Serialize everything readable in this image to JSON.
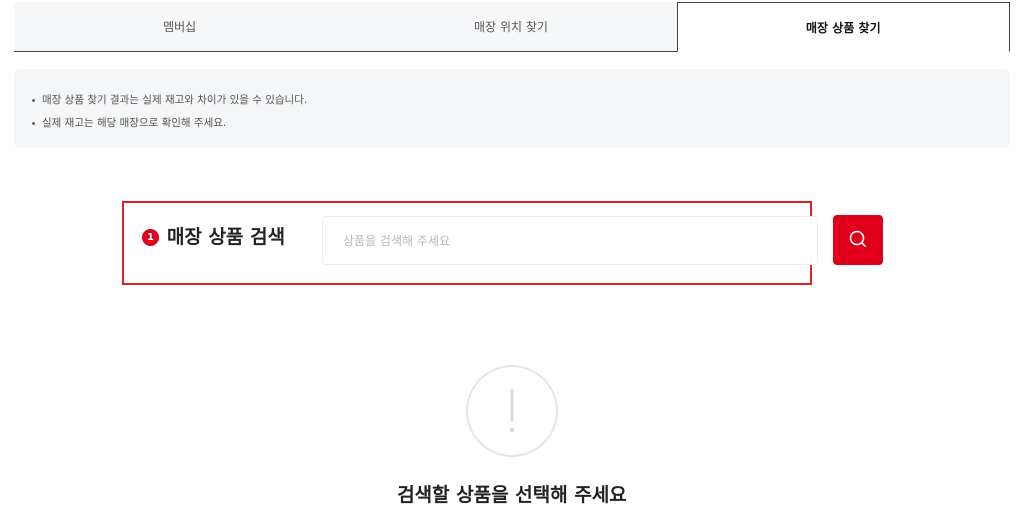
{
  "tabs": [
    {
      "label": "멤버십",
      "active": false
    },
    {
      "label": "매장 위치 찾기",
      "active": false
    },
    {
      "label": "매장 상품 찾기",
      "active": true
    }
  ],
  "notice": {
    "items": [
      "매장 상품 찾기 결과는 실제 재고와 차이가 있을 수 있습니다.",
      "실제 재고는 해당 매장으로 확인해 주세요."
    ]
  },
  "search": {
    "step_number": "1",
    "label": "매장 상품 검색",
    "placeholder": "상품을 검색해 주세요",
    "value": "",
    "button_icon": "search-icon"
  },
  "empty_state": {
    "icon": "exclamation-circle-icon",
    "message": "검색할 상품을 선택해 주세요"
  },
  "colors": {
    "accent": "#e0001b",
    "highlight_border": "#e0202a",
    "notice_bg": "#f5f6f8"
  }
}
